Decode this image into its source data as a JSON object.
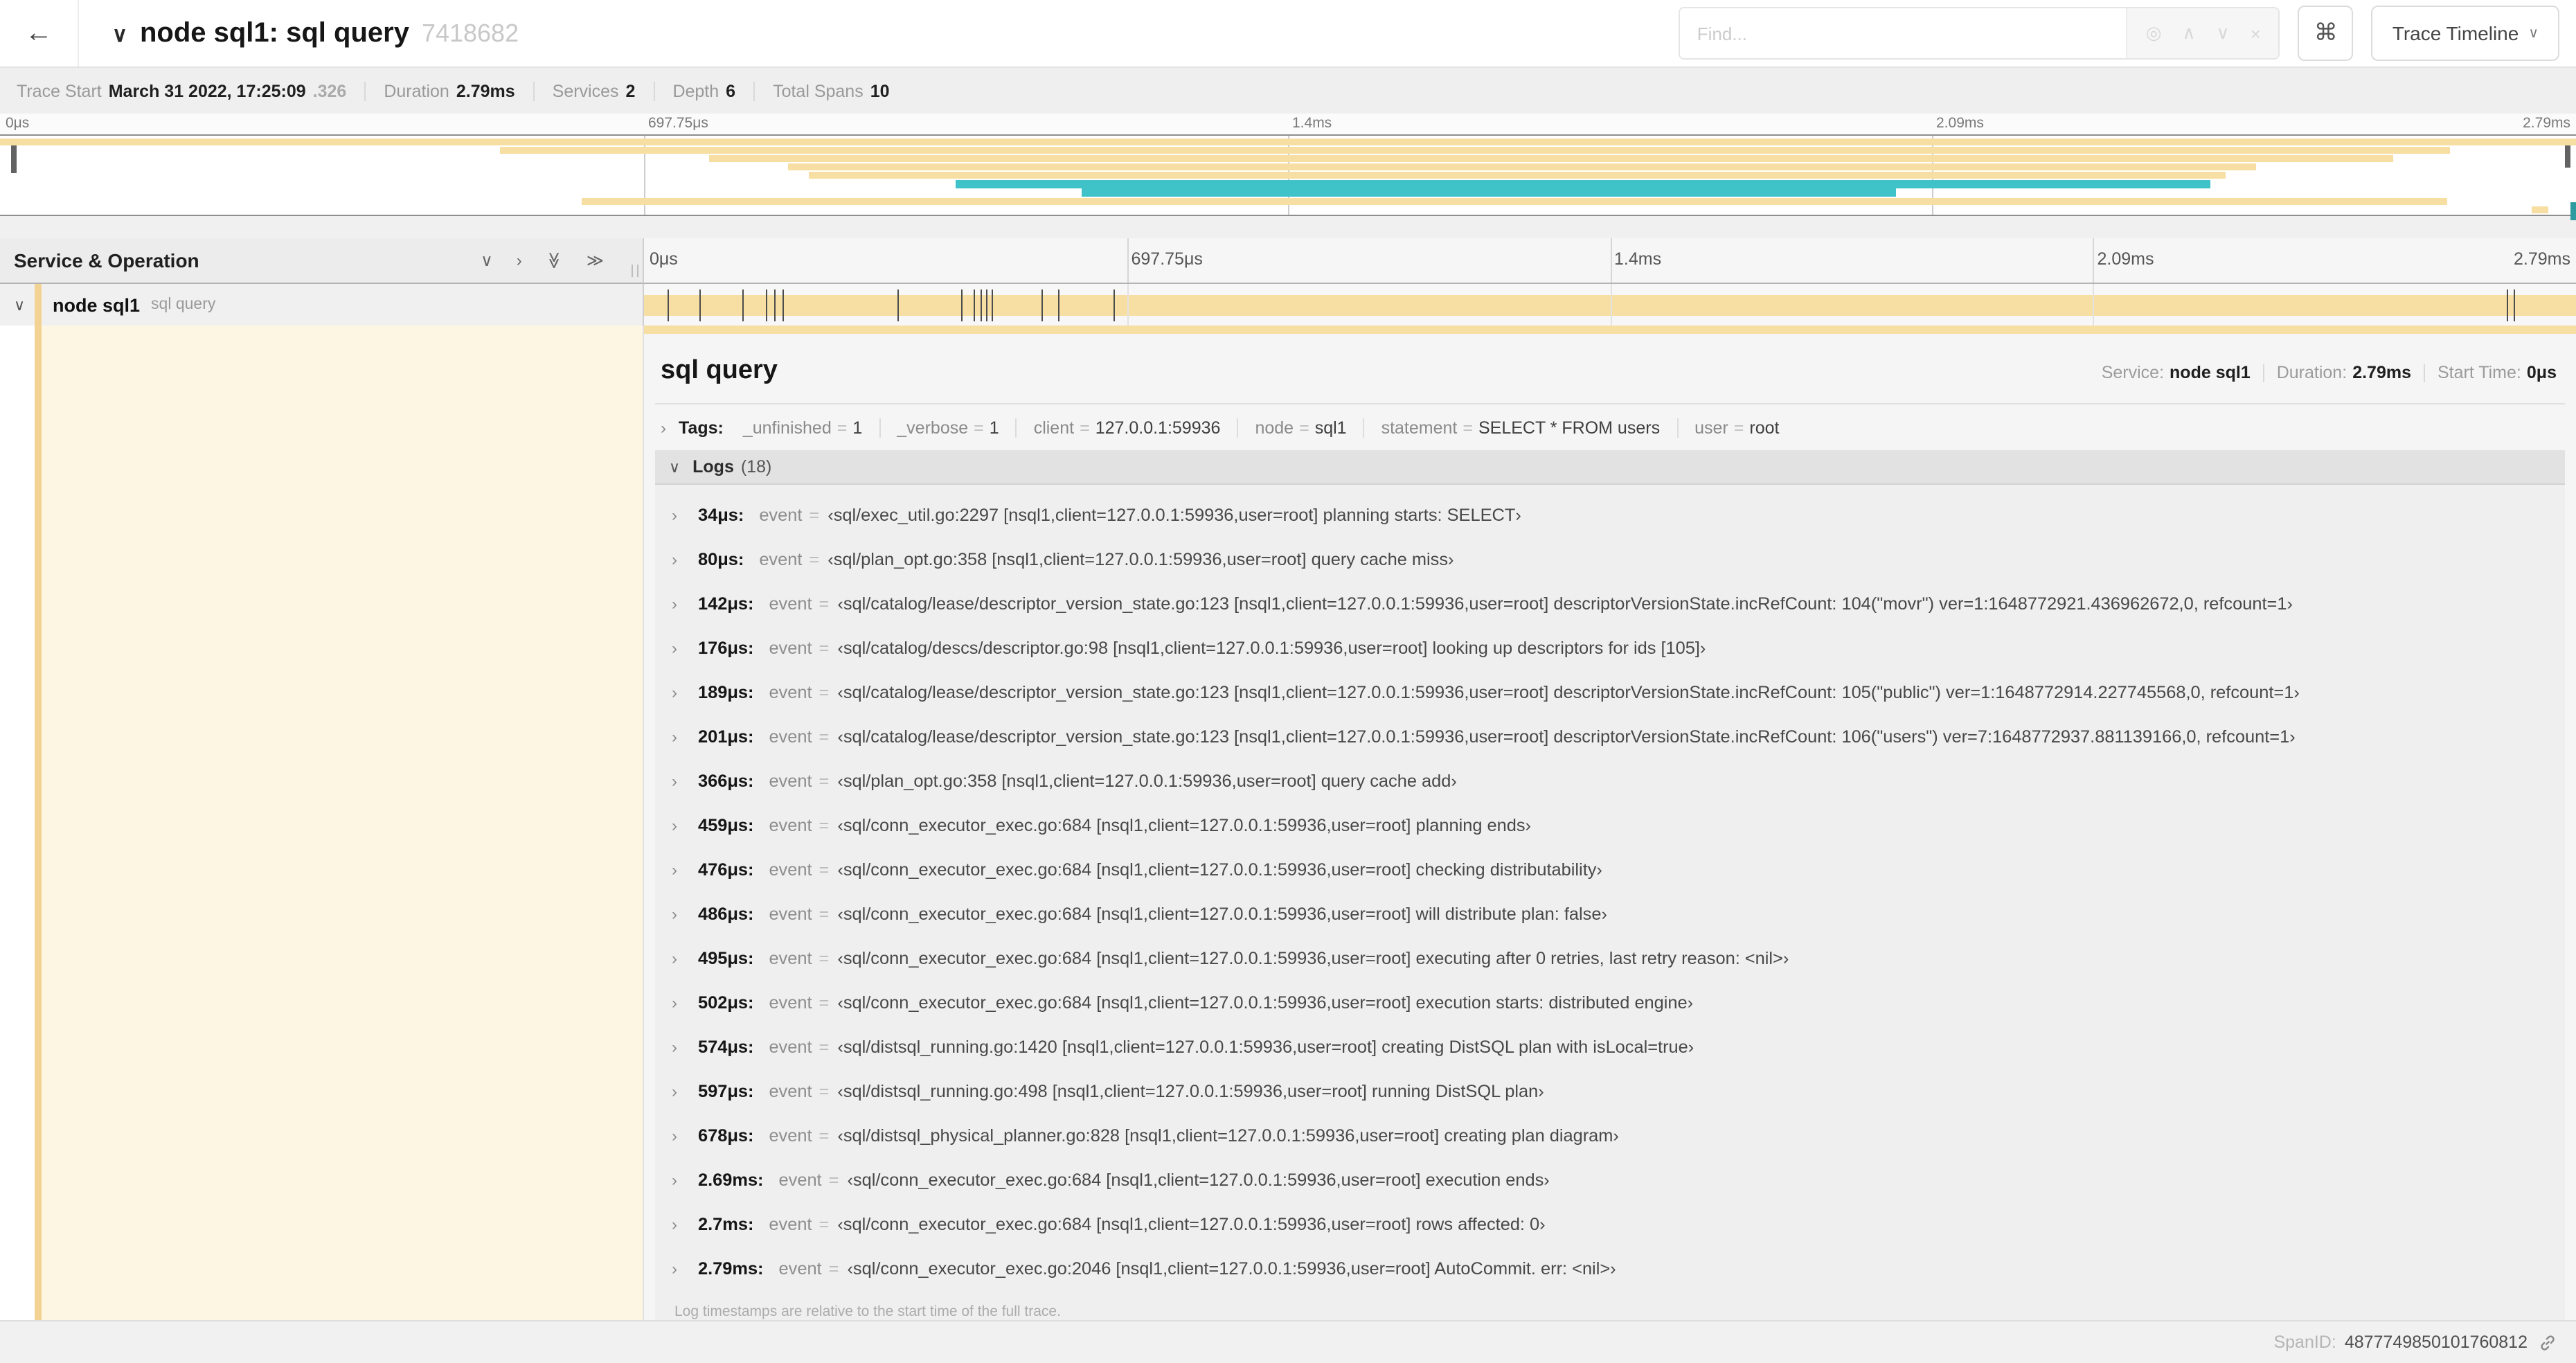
{
  "colors": {
    "tan": "#f7dfa4",
    "teal": "#3fc3c9",
    "accent": "#f3d394",
    "cream": "#fdf6e3"
  },
  "topbar": {
    "back": "←",
    "collapse_chevron": "∨",
    "title": "node sql1: sql query",
    "trace_id": "7418682",
    "find_placeholder": "Find...",
    "find_icons": {
      "target": "◎",
      "prev": "∧",
      "next": "∨",
      "clear": "×"
    },
    "shortcut": "⌘",
    "view_button": {
      "label": "Trace Timeline",
      "chevron": "∨"
    }
  },
  "trace_info": [
    {
      "label": "Trace Start",
      "value": "March 31 2022, 17:25:09",
      "suffix": ".326"
    },
    {
      "label": "Duration",
      "value": "2.79ms",
      "suffix": ""
    },
    {
      "label": "Services",
      "value": "2",
      "suffix": ""
    },
    {
      "label": "Depth",
      "value": "6",
      "suffix": ""
    },
    {
      "label": "Total Spans",
      "value": "10",
      "suffix": ""
    }
  ],
  "timeline": {
    "ticks": [
      {
        "label": "0μs",
        "pos": 0
      },
      {
        "label": "697.75μs",
        "pos": 25
      },
      {
        "label": "1.4ms",
        "pos": 50
      },
      {
        "label": "2.09ms",
        "pos": 75
      },
      {
        "label": "2.79ms",
        "pos": 100
      }
    ],
    "grid_pcts": [
      25,
      50,
      75
    ],
    "minimap_spans": [
      {
        "color": "tan",
        "left": 0,
        "width": 100
      },
      {
        "color": "tan",
        "left": 19.4,
        "width": 75.7
      },
      {
        "color": "tan",
        "left": 27.5,
        "width": 65.4
      },
      {
        "color": "tan",
        "left": 30.6,
        "width": 57.0
      },
      {
        "color": "tan",
        "left": 31.4,
        "width": 55.0
      },
      {
        "color": "teal",
        "left": 37.1,
        "width": 48.7
      },
      {
        "color": "teal",
        "left": 42.0,
        "width": 31.6
      },
      {
        "color": "tan",
        "left": 22.6,
        "width": 72.4
      },
      {
        "color": "tan",
        "left": 98.3,
        "width": 0.6
      }
    ],
    "log_tick_pcts": [
      1.22,
      2.87,
      5.09,
      6.31,
      6.77,
      7.2,
      13.12,
      16.45,
      17.06,
      17.42,
      17.74,
      18.0,
      20.57,
      21.4,
      24.3,
      96.42,
      96.77
    ]
  },
  "left_panel": {
    "title": "Service & Operation",
    "icons": {
      "collapse_one": "∨",
      "expand_one": "›",
      "collapse_all": "≫",
      "expand_all": "≫"
    },
    "row": {
      "chevron": "∨",
      "service": "node sql1",
      "operation": "sql query"
    }
  },
  "detail": {
    "title": "sql query",
    "meta": [
      {
        "label": "Service:",
        "value": "node sql1"
      },
      {
        "label": "Duration:",
        "value": "2.79ms"
      },
      {
        "label": "Start Time:",
        "value": "0μs"
      }
    ],
    "tags": {
      "chevron": "›",
      "label": "Tags:",
      "items": [
        {
          "key": "_unfinished",
          "value": "1"
        },
        {
          "key": "_verbose",
          "value": "1"
        },
        {
          "key": "client",
          "value": "127.0.0.1:59936"
        },
        {
          "key": "node",
          "value": "sql1"
        },
        {
          "key": "statement",
          "value": "SELECT * FROM users"
        },
        {
          "key": "user",
          "value": "root"
        }
      ]
    },
    "logs": {
      "chevron": "∨",
      "label": "Logs",
      "count": "(18)",
      "field": "event",
      "eq": "=",
      "rows": [
        {
          "time": "34μs:",
          "value": "‹sql/exec_util.go:2297 [nsql1,client=127.0.0.1:59936,user=root] planning starts: SELECT›"
        },
        {
          "time": "80μs:",
          "value": "‹sql/plan_opt.go:358 [nsql1,client=127.0.0.1:59936,user=root] query cache miss›"
        },
        {
          "time": "142μs:",
          "value": "‹sql/catalog/lease/descriptor_version_state.go:123 [nsql1,client=127.0.0.1:59936,user=root] descriptorVersionState.incRefCount: 104(\"movr\") ver=1:1648772921.436962672,0, refcount=1›"
        },
        {
          "time": "176μs:",
          "value": "‹sql/catalog/descs/descriptor.go:98 [nsql1,client=127.0.0.1:59936,user=root] looking up descriptors for ids [105]›"
        },
        {
          "time": "189μs:",
          "value": "‹sql/catalog/lease/descriptor_version_state.go:123 [nsql1,client=127.0.0.1:59936,user=root] descriptorVersionState.incRefCount: 105(\"public\") ver=1:1648772914.227745568,0, refcount=1›"
        },
        {
          "time": "201μs:",
          "value": "‹sql/catalog/lease/descriptor_version_state.go:123 [nsql1,client=127.0.0.1:59936,user=root] descriptorVersionState.incRefCount: 106(\"users\") ver=7:1648772937.881139166,0, refcount=1›"
        },
        {
          "time": "366μs:",
          "value": "‹sql/plan_opt.go:358 [nsql1,client=127.0.0.1:59936,user=root] query cache add›"
        },
        {
          "time": "459μs:",
          "value": "‹sql/conn_executor_exec.go:684 [nsql1,client=127.0.0.1:59936,user=root] planning ends›"
        },
        {
          "time": "476μs:",
          "value": "‹sql/conn_executor_exec.go:684 [nsql1,client=127.0.0.1:59936,user=root] checking distributability›"
        },
        {
          "time": "486μs:",
          "value": "‹sql/conn_executor_exec.go:684 [nsql1,client=127.0.0.1:59936,user=root] will distribute plan: false›"
        },
        {
          "time": "495μs:",
          "value": "‹sql/conn_executor_exec.go:684 [nsql1,client=127.0.0.1:59936,user=root] executing after 0 retries, last retry reason: <nil>›"
        },
        {
          "time": "502μs:",
          "value": "‹sql/conn_executor_exec.go:684 [nsql1,client=127.0.0.1:59936,user=root] execution starts: distributed engine›"
        },
        {
          "time": "574μs:",
          "value": "‹sql/distsql_running.go:1420 [nsql1,client=127.0.0.1:59936,user=root] creating DistSQL plan with isLocal=true›"
        },
        {
          "time": "597μs:",
          "value": "‹sql/distsql_running.go:498 [nsql1,client=127.0.0.1:59936,user=root] running DistSQL plan›"
        },
        {
          "time": "678μs:",
          "value": "‹sql/distsql_physical_planner.go:828 [nsql1,client=127.0.0.1:59936,user=root] creating plan diagram›"
        },
        {
          "time": "2.69ms:",
          "value": "‹sql/conn_executor_exec.go:684 [nsql1,client=127.0.0.1:59936,user=root] execution ends›"
        },
        {
          "time": "2.7ms:",
          "value": "‹sql/conn_executor_exec.go:684 [nsql1,client=127.0.0.1:59936,user=root] rows affected: 0›"
        },
        {
          "time": "2.79ms:",
          "value": "‹sql/conn_executor_exec.go:2046 [nsql1,client=127.0.0.1:59936,user=root] AutoCommit. err: <nil>›"
        }
      ],
      "note": "Log timestamps are relative to the start time of the full trace."
    }
  },
  "footer": {
    "label": "SpanID:",
    "value": "4877749850101760812"
  }
}
